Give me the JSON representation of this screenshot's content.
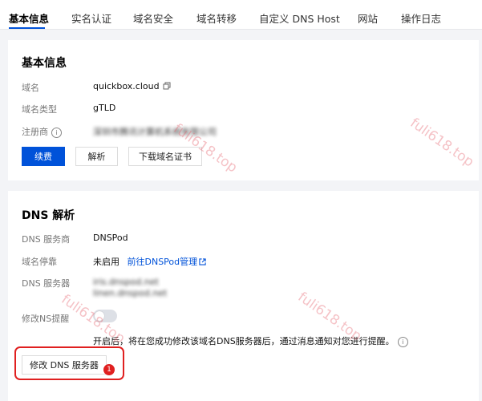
{
  "tabs": [
    {
      "label": "基本信息",
      "active": true
    },
    {
      "label": "实名认证"
    },
    {
      "label": "域名安全"
    },
    {
      "label": "域名转移"
    },
    {
      "label": "自定义 DNS Host"
    },
    {
      "label": "网站"
    },
    {
      "label": "操作日志"
    }
  ],
  "basic": {
    "title": "基本信息",
    "domain_label": "域名",
    "domain_value": "quickbox.cloud",
    "type_label": "域名类型",
    "type_value": "gTLD",
    "registrar_label": "注册商",
    "registrar_value": "深圳市腾讯计算机系统有限公司",
    "buttons": {
      "renew": "续费",
      "resolve": "解析",
      "cert": "下载域名证书"
    }
  },
  "dns": {
    "title": "DNS 解析",
    "provider_label": "DNS 服务商",
    "provider_value": "DNSPod",
    "parking_label": "域名停靠",
    "parking_status": "未启用",
    "parking_link": "前往DNSPod管理",
    "servers_label": "DNS 服务器",
    "servers": [
      "iris.dnspod.net",
      "linen.dnspod.net"
    ],
    "ns_reminder_label": "修改NS提醒",
    "ns_reminder_enabled": false,
    "note": "开启后，将在您成功修改该域名DNS服务器后，通过消息通知对您进行提醒。",
    "modify_button": "修改 DNS 服务器",
    "badge": "1"
  },
  "watermark": "fuli618.top",
  "colors": {
    "primary": "#0052d9",
    "highlight": "#e02020"
  }
}
